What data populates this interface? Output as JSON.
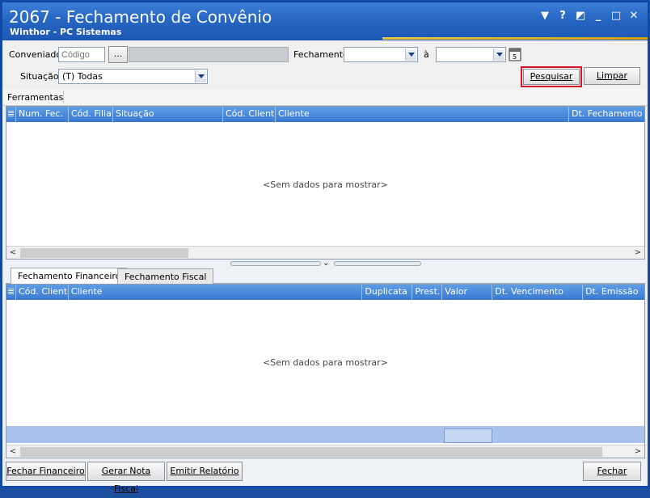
{
  "window": {
    "title": "2067 - Fechamento de Convênio",
    "subtitle": "Winthor - PC Sistemas",
    "controls": [
      "▼",
      "?",
      "◩",
      "_",
      "□",
      "✕"
    ]
  },
  "filters": {
    "conveniado_label": "Conveniado",
    "codigo_placeholder": "Código",
    "browse_label": "...",
    "fechamento_label": "Fechamento",
    "a_label": "à",
    "situacao_label": "Situação",
    "situacao_value": "(T) Todas",
    "pesquisar_label": "Pesquisar",
    "limpar_label": "Limpar"
  },
  "toolbar": {
    "ferramentas_label": "Ferramentas"
  },
  "grid1": {
    "columns": [
      "Num. Fec.",
      "Cód. Filial",
      "Situação",
      "Cód. Cliente",
      "Cliente",
      "Dt. Fechamento Pr"
    ],
    "empty_text": "<Sem dados para mostrar>"
  },
  "tabs": {
    "items": [
      "Fechamento Financeiro",
      "Fechamento Fiscal"
    ],
    "active": "Fechamento Financeiro"
  },
  "grid2": {
    "columns": [
      "Cód. Cliente",
      "Cliente",
      "Duplicata",
      "Prest.",
      "Valor",
      "Dt. Vencimento",
      "Dt. Emissão"
    ],
    "empty_text": "<Sem dados para mostrar>"
  },
  "footer": {
    "fechar_financeiro_label": "Fechar Financeiro",
    "gerar_nota_label": "Gerar Nota Fiscal",
    "emitir_relatorio_label": "Emitir Relatório",
    "fechar_label": "Fechar"
  },
  "colors": {
    "title_bar": "#2766c4",
    "grid_header": "#3a78cf",
    "highlight": "#d8142a"
  }
}
